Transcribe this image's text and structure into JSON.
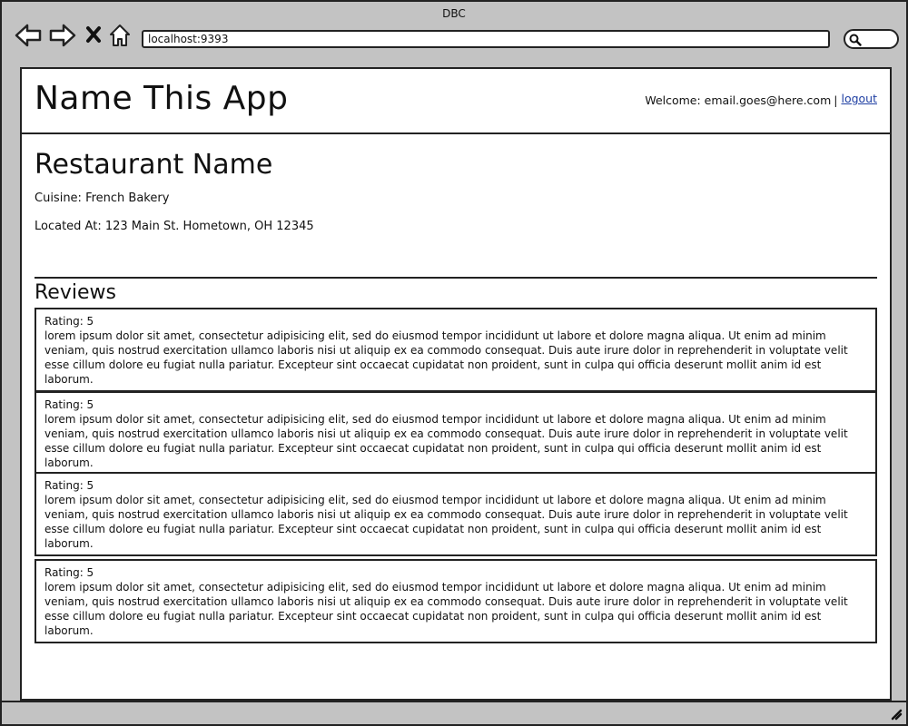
{
  "browser": {
    "title": "DBC",
    "url": "localhost:9393"
  },
  "header": {
    "app_title": "Name This App",
    "welcome_text": "Welcome: email.goes@here.com",
    "separator": "|",
    "logout_label": "logout"
  },
  "restaurant": {
    "name": "Restaurant Name",
    "cuisine_line": "Cuisine: French Bakery",
    "location_line": "Located At: 123 Main St. Hometown, OH 12345"
  },
  "reviews": {
    "heading": "Reviews",
    "items": [
      {
        "rating": "Rating: 5",
        "body": "lorem ipsum dolor sit amet, consectetur adipisicing elit, sed do eiusmod tempor incididunt ut labore et dolore magna aliqua. Ut enim ad minim veniam, quis nostrud exercitation ullamco laboris nisi ut aliquip ex ea commodo consequat. Duis aute irure dolor in reprehenderit in voluptate velit esse cillum dolore eu fugiat nulla pariatur. Excepteur sint occaecat cupidatat non proident, sunt in culpa qui officia deserunt mollit anim id est laborum."
      },
      {
        "rating": "Rating: 5",
        "body": "lorem ipsum dolor sit amet, consectetur adipisicing elit, sed do eiusmod tempor incididunt ut labore et dolore magna aliqua. Ut enim ad minim veniam, quis nostrud exercitation ullamco laboris nisi ut aliquip ex ea commodo consequat. Duis aute irure dolor in reprehenderit in voluptate velit esse cillum dolore eu fugiat nulla pariatur. Excepteur sint occaecat cupidatat non proident, sunt in culpa qui officia deserunt mollit anim id est laborum."
      },
      {
        "rating": "Rating: 5",
        "body": "lorem ipsum dolor sit amet, consectetur adipisicing elit, sed do eiusmod tempor incididunt ut labore et dolore magna aliqua. Ut enim ad minim veniam, quis nostrud exercitation ullamco laboris nisi ut aliquip ex ea commodo consequat. Duis aute irure dolor in reprehenderit in voluptate velit esse cillum dolore eu fugiat nulla pariatur. Excepteur sint occaecat cupidatat non proident, sunt in culpa qui officia deserunt mollit anim id est laborum."
      },
      {
        "rating": "Rating: 5",
        "body": "lorem ipsum dolor sit amet, consectetur adipisicing elit, sed do eiusmod tempor incididunt ut labore et dolore magna aliqua. Ut enim ad minim veniam, quis nostrud exercitation ullamco laboris nisi ut aliquip ex ea commodo consequat. Duis aute irure dolor in reprehenderit in voluptate velit esse cillum dolore eu fugiat nulla pariatur. Excepteur sint occaecat cupidatat non proident, sunt in culpa qui officia deserunt mollit anim id est laborum."
      }
    ]
  },
  "icons": {
    "back": "back-arrow-icon",
    "forward": "forward-arrow-icon",
    "stop": "close-icon",
    "home": "home-icon",
    "search": "search-icon",
    "resize": "resize-grip-icon"
  },
  "colors": {
    "chrome": "#c3c3c3",
    "link": "#1f3fa3",
    "border": "#222222"
  }
}
